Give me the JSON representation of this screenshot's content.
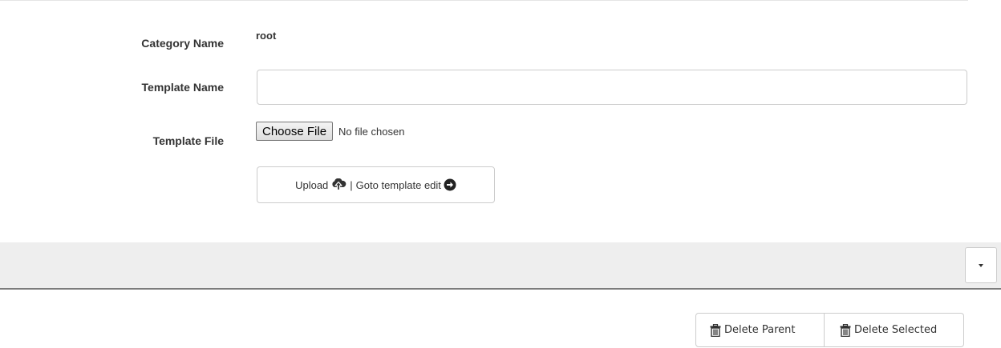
{
  "form": {
    "category_label": "Category Name",
    "category_value": "root",
    "template_name_label": "Template Name",
    "template_name_value": "",
    "template_file_label": "Template File",
    "choose_file_label": "Choose File",
    "file_status": "No file chosen",
    "upload_label": "Upload",
    "separator": "|",
    "goto_label": "Goto template edit"
  },
  "toolbar": {
    "dropdown_icon": "caret-down-icon"
  },
  "actions": {
    "delete_parent_label": "Delete Parent",
    "delete_selected_label": "Delete Selected",
    "icon": "trash-icon"
  }
}
